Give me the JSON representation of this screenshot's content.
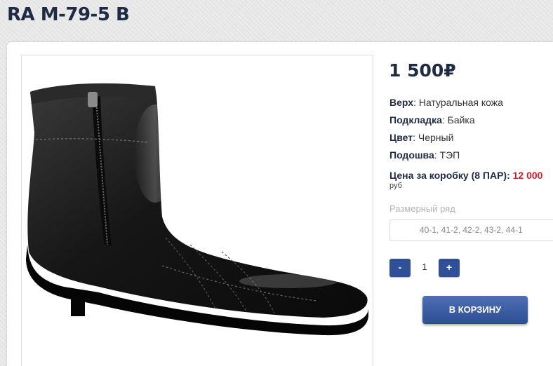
{
  "product": {
    "title": "RA M-79-5 B",
    "price": "1 500₽",
    "image_icon": "boot-image",
    "specs": [
      {
        "label": "Верх",
        "value": ": Натуральная кожа"
      },
      {
        "label": "Подкладка",
        "value": ": Байка"
      },
      {
        "label": "Цвет",
        "value": ": Черный"
      },
      {
        "label": "Подошва",
        "value": ": ТЭП"
      }
    ],
    "box_price": {
      "label": "Цена за коробку (8 ПАР): ",
      "value": "12 000",
      "currency": "руб"
    },
    "size_label": "Размерный ряд",
    "size_value": "40-1, 41-2, 42-2, 43-2, 44-1",
    "quantity": {
      "minus": "-",
      "value": "1",
      "plus": "+"
    },
    "cart_label": "В КОРЗИНУ"
  },
  "colors": {
    "accent": "#2f4f96",
    "title": "#1f2a44",
    "highlight": "#d0202a"
  }
}
